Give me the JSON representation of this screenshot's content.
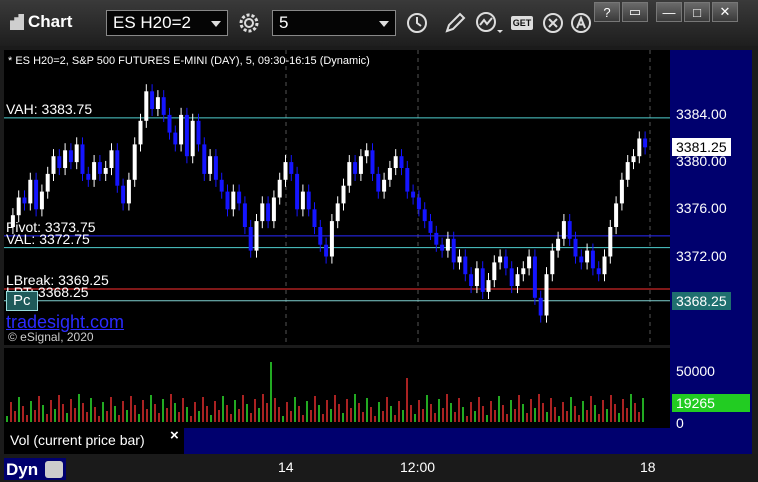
{
  "titlebar": {
    "title": "Chart"
  },
  "toolbar": {
    "symbol": "ES H20=2",
    "interval": "5",
    "get_label": "GET"
  },
  "window": {
    "help": "?",
    "restore": "▭",
    "minimize": "—",
    "maximize": "□",
    "close": "✕"
  },
  "chart": {
    "header": "* ES H20=2, S&P 500 FUTURES E-MINI (DAY), 5, 09:30-16:15 (Dynamic)",
    "watermark": "tradesight.com",
    "copyright": "© eSignal, 2020",
    "pc_button": "Pc"
  },
  "levels": [
    {
      "label": "VAH: 3383.75",
      "value": 3383.75,
      "color": "#4fd0d0"
    },
    {
      "label": "Pivot: 3373.75",
      "value": 3373.75,
      "color": "#2a2aff"
    },
    {
      "label": "VAL: 3372.75",
      "value": 3372.75,
      "color": "#4fd0d0"
    },
    {
      "label": "LBreak: 3369.25",
      "value": 3369.25,
      "color": "#ff3030"
    },
    {
      "label": "LPT: 3368.25",
      "value": 3368.25,
      "color": "#7fd0d0"
    }
  ],
  "price_axis": {
    "ticks": [
      "3384.00",
      "3380.00",
      "3376.00",
      "3372.00"
    ],
    "last_price": "3381.25",
    "lpt_badge": "3368.25"
  },
  "volume": {
    "ticks": [
      "50000",
      "0"
    ],
    "current": "19265",
    "label": "Vol (current price bar)",
    "close": "×"
  },
  "time_axis": {
    "ticks": [
      "14",
      "12:00",
      "18"
    ]
  },
  "bottom": {
    "workspace": "Dyn"
  },
  "colors": {
    "up": "#ffffff",
    "down": "#1515ff",
    "grid": "#555555",
    "axis_bg": "#00006e",
    "counter": "#22cc22",
    "vol_badge": "#22cc22"
  },
  "chart_data": {
    "type": "candlestick",
    "title": "* ES H20=2, S&P 500 FUTURES E-MINI (DAY), 5, 09:30-16:15 (Dynamic)",
    "ylim": [
      3364.5,
      3389.5
    ],
    "closes": [
      3375.5,
      3377,
      3376.5,
      3378.5,
      3376,
      3377.5,
      3379,
      3380.5,
      3379.5,
      3381,
      3380,
      3381.5,
      3379,
      3378.5,
      3380,
      3379,
      3379.5,
      3381,
      3378,
      3376.5,
      3378.5,
      3381.5,
      3383.5,
      3386,
      3384.5,
      3385.5,
      3384,
      3382.5,
      3381.5,
      3384,
      3380.5,
      3383.5,
      3381.5,
      3379,
      3380.5,
      3378.5,
      3377.5,
      3376,
      3377.5,
      3376.5,
      3374.5,
      3372.5,
      3375,
      3376.5,
      3375,
      3377,
      3378.5,
      3380,
      3379,
      3376,
      3377.5,
      3376,
      3374.5,
      3373,
      3372,
      3375,
      3376.5,
      3378,
      3380,
      3379,
      3380.5,
      3381,
      3379,
      3377.5,
      3378.5,
      3379.5,
      3380.5,
      3379.5,
      3377.5,
      3377,
      3376,
      3375,
      3374,
      3373,
      3372.5,
      3373.5,
      3371.5,
      3372,
      3370.5,
      3369.5,
      3371,
      3369,
      3370,
      3371.5,
      3372,
      3371,
      3369.5,
      3370.5,
      3371,
      3372,
      3368.5,
      3367,
      3370.5,
      3372.5,
      3373.5,
      3375,
      3373.5,
      3372,
      3371.5,
      3372.5,
      3371,
      3370.5,
      3372,
      3374.5,
      3376.5,
      3378.5,
      3380,
      3380.5,
      3382,
      3381.25
    ]
  }
}
